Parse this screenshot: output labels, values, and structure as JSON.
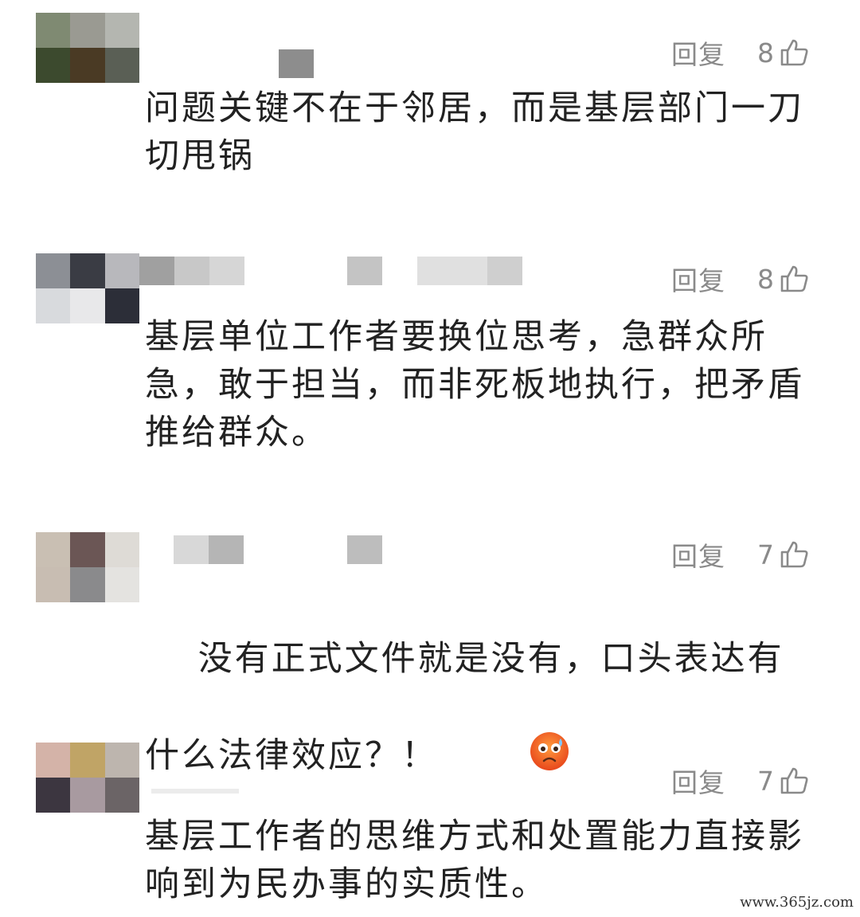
{
  "comments": [
    {
      "reply_label": "回复",
      "likes": "8",
      "text": "问题关键不在于邻居，而是基层部门一刀切甩锅",
      "avatar_colors": [
        "#7f8a72",
        "#9a9a92",
        "#b4b6b0",
        "#3c4a2e",
        "#4a3a24",
        "#5a5f55"
      ],
      "name_mosaic": [
        "#8d8d8d"
      ]
    },
    {
      "reply_label": "回复",
      "likes": "8",
      "text": "基层单位工作者要换位思考，急群众所急，敢于担当，而非死板地执行，把矛盾推给群众。",
      "avatar_colors": [
        "#8c8f95",
        "#3a3c44",
        "#b8b8bc",
        "#d8dadd",
        "#e8e8ea",
        "#2c2e38"
      ],
      "name_mosaic": [
        "#a0a0a0",
        "#c8c8c8",
        "#d6d6d6"
      ]
    },
    {
      "reply_label": "回复",
      "likes": "7",
      "text": "没有正式文件就是没有，口头表达有什么法律效应？！",
      "avatar_colors": [
        "#c9bfb3",
        "#6b5655",
        "#dedbd6",
        "#c8bdb2",
        "#8a8a8c",
        "#e4e3e0"
      ],
      "name_mosaic": [
        "#d8d8d8",
        "#b5b5b5"
      ]
    },
    {
      "reply_label": "回复",
      "likes": "7",
      "text": "基层工作者的思维方式和处置能力直接影响到为民办事的实质性。",
      "avatar_colors": [
        "#d4b3a8",
        "#c0a466",
        "#bdb5ae",
        "#3c3640",
        "#a89aa0",
        "#6b6466"
      ],
      "name_mosaic": []
    }
  ],
  "watermark": "www.365jz.com",
  "icons": {
    "like": "thumbs-up-icon",
    "emoji": "anxious-face-emoji"
  }
}
